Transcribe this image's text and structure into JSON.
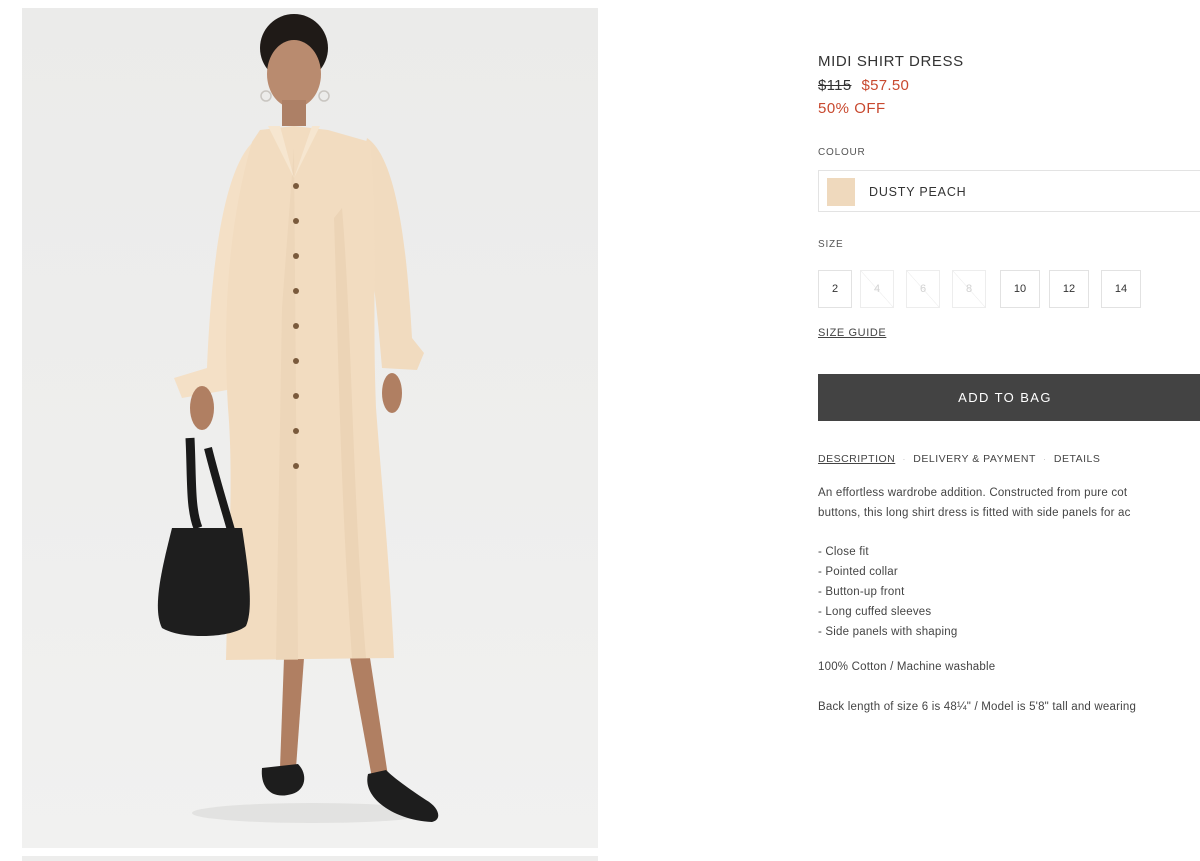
{
  "product": {
    "name": "MIDI SHIRT DRESS",
    "original_price": "$115",
    "sale_price": "$57.50",
    "discount": "50% OFF"
  },
  "colour": {
    "label": "COLOUR",
    "selected": "DUSTY PEACH",
    "swatch_color": "#efd9bd"
  },
  "size": {
    "label": "SIZE",
    "options": [
      {
        "value": "2",
        "available": true
      },
      {
        "value": "4",
        "available": false
      },
      {
        "value": "6",
        "available": false
      },
      {
        "value": "8",
        "available": false
      },
      {
        "value": "10",
        "available": true
      },
      {
        "value": "12",
        "available": true
      },
      {
        "value": "14",
        "available": true
      }
    ],
    "guide": "SIZE GUIDE"
  },
  "actions": {
    "add_to_bag": "ADD TO BAG"
  },
  "tabs": [
    {
      "label": "DESCRIPTION",
      "active": true
    },
    {
      "label": "DELIVERY & PAYMENT",
      "active": false
    },
    {
      "label": "DETAILS",
      "active": false
    }
  ],
  "description": {
    "line1": "An effortless wardrobe addition. Constructed from pure cot",
    "line2": "buttons, this long shirt dress is fitted with side panels for ac",
    "bullets": [
      "- Close fit",
      "- Pointed collar",
      "- Button-up front",
      "- Long cuffed sleeves",
      "- Side panels with shaping"
    ],
    "composition": "100% Cotton / Machine washable",
    "measurements": "Back length of size 6 is 48¼\" / Model is 5'8\" tall and wearing"
  },
  "colors": {
    "sale": "#c8492f",
    "button_bg": "#434343",
    "dress": "#f2dcc0"
  }
}
